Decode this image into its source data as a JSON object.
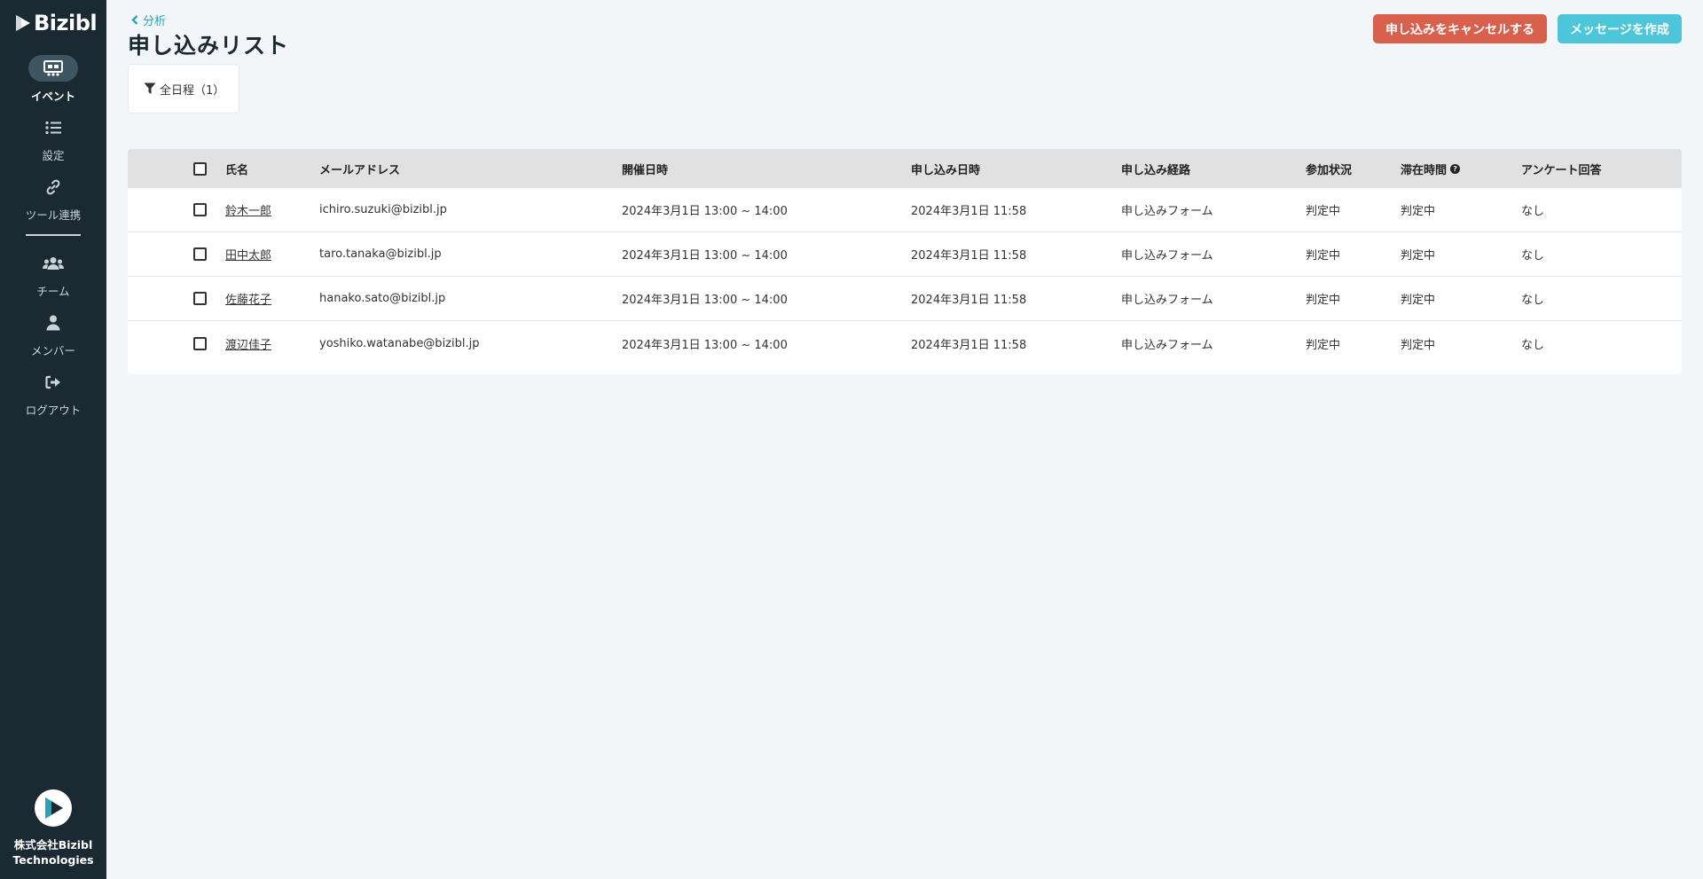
{
  "sidebar": {
    "logo_text": "Bizibl",
    "items": [
      {
        "label": "イベント",
        "icon": "event-icon",
        "active": true
      },
      {
        "label": "設定",
        "icon": "list-icon",
        "active": false
      },
      {
        "label": "ツール連携",
        "icon": "link-icon",
        "active": false
      },
      {
        "label": "チーム",
        "icon": "team-icon",
        "active": false
      },
      {
        "label": "メンバー",
        "icon": "user-icon",
        "active": false
      },
      {
        "label": "ログアウト",
        "icon": "logout-icon",
        "active": false
      }
    ],
    "company": {
      "line1": "株式会社Bizibl",
      "line2": "Technologies"
    }
  },
  "header": {
    "back_label": "分析",
    "title": "申し込みリスト",
    "cancel_button": "申し込みをキャンセルする",
    "message_button": "メッセージを作成"
  },
  "filter": {
    "label": "全日程（1）"
  },
  "table": {
    "columns": [
      "氏名",
      "メールアドレス",
      "開催日時",
      "申し込み日時",
      "申し込み経路",
      "参加状況",
      "滞在時間",
      "アンケート回答"
    ],
    "rows": [
      {
        "name": "鈴木一郎",
        "email": "ichiro.suzuki@bizibl.jp",
        "event_date": "2024年3月1日 13:00 ~ 14:00",
        "applied_at": "2024年3月1日 11:58",
        "route": "申し込みフォーム",
        "status": "判定中",
        "stay": "判定中",
        "survey": "なし"
      },
      {
        "name": "田中太郎",
        "email": "taro.tanaka@bizibl.jp",
        "event_date": "2024年3月1日 13:00 ~ 14:00",
        "applied_at": "2024年3月1日 11:58",
        "route": "申し込みフォーム",
        "status": "判定中",
        "stay": "判定中",
        "survey": "なし"
      },
      {
        "name": "佐藤花子",
        "email": "hanako.sato@bizibl.jp",
        "event_date": "2024年3月1日 13:00 ~ 14:00",
        "applied_at": "2024年3月1日 11:58",
        "route": "申し込みフォーム",
        "status": "判定中",
        "stay": "判定中",
        "survey": "なし"
      },
      {
        "name": "渡辺佳子",
        "email": "yoshiko.watanabe@bizibl.jp",
        "event_date": "2024年3月1日 13:00 ~ 14:00",
        "applied_at": "2024年3月1日 11:58",
        "route": "申し込みフォーム",
        "status": "判定中",
        "stay": "判定中",
        "survey": "なし"
      }
    ]
  },
  "colors": {
    "sidebar_bg": "#1b2a32",
    "accent": "#2aa3b8",
    "cancel": "#d9604d",
    "message": "#4cc6d8"
  }
}
